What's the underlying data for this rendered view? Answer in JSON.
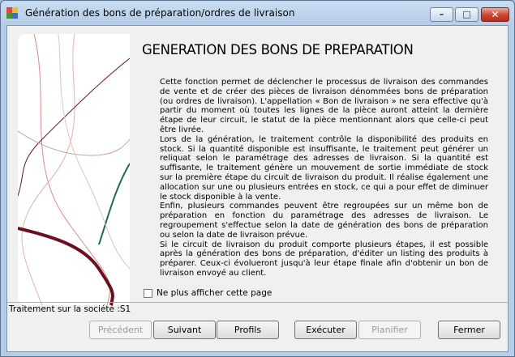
{
  "window": {
    "title": "Génération des bons de préparation/ordres de livraison",
    "min_glyph": "–",
    "max_glyph": "□",
    "close_glyph": "✕"
  },
  "page": {
    "heading": "GENERATION DES BONS DE PREPARATION",
    "paragraphs": [
      "Cette fonction permet de déclencher le processus de livraison des commandes de vente et de créer des pièces de livraison dénommées bons de préparation (ou ordres de livraison). L'appellation « Bon de livraison » ne sera effective qu'à partir du moment où toutes les lignes de la pièce auront atteint la dernière étape de leur circuit, le statut de la pièce mentionnant alors que celle-ci peut être livrée.",
      "Lors de la génération, le traitement contrôle la disponibilité des produits en stock. Si la quantité disponible est insuffisante, le traitement peut générer un reliquat selon le paramétrage des adresses de livraison. Si la quantité est suffisante, le traitement génère un mouvement de sortie immédiate de stock sur la première étape du circuit de livraison du produit. Il réalise également une allocation sur une ou plusieurs entrées en stock, ce qui a pour effet de diminuer le stock disponible à la vente.",
      "Enfin, plusieurs commandes peuvent être regroupées sur un même bon de préparation en fonction du paramétrage des adresses de livraison. Le regroupement s'effectue selon la date de génération des bons de préparation ou selon la date de livraison prévue.",
      "Si le circuit de livraison du produit comporte plusieurs étapes, il est possible après la génération des bons de préparation, d'éditer un listing des produits à préparer. Ceux-ci évolueront jusqu'à leur étape finale afin d'obtenir un bon de livraison envoyé au client."
    ],
    "checkbox_label": "Ne plus afficher cette page",
    "checkbox_checked": false,
    "company_label": "Traitement sur la société :S1"
  },
  "buttons": {
    "previous": "Précédent",
    "next": "Suivant",
    "profiles": "Profils",
    "execute": "Exécuter",
    "schedule": "Planifier",
    "close": "Fermer"
  },
  "colors": {
    "art_dark_red": "#6b0f1e",
    "art_green": "#1f6b4e",
    "art_pink": "#d88a8a"
  }
}
